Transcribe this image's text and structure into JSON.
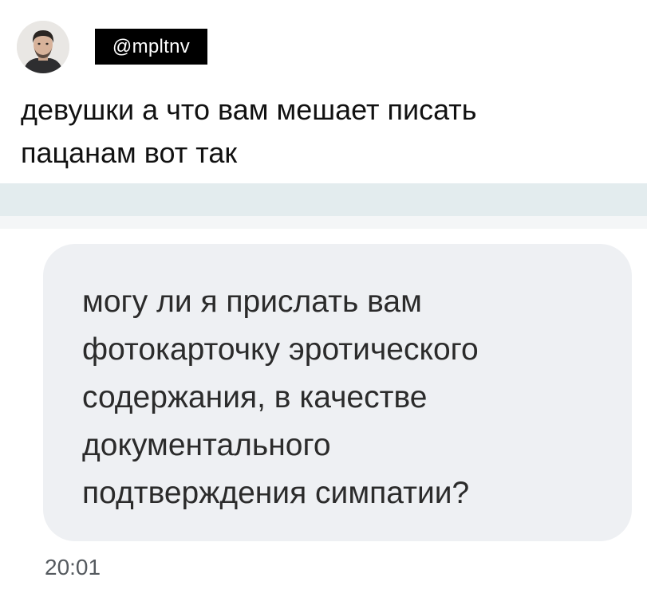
{
  "post": {
    "username": "@mpltnv",
    "text_lines": [
      "девушки а что вам мешает писать",
      "пацанам вот так"
    ]
  },
  "message": {
    "text_lines": [
      "могу ли я прислать вам",
      "фотокарточку эротического",
      "содержания, в качестве",
      "документального",
      "подтверждения симпатии?"
    ],
    "time": "20:01"
  },
  "colors": {
    "separator": "#e3ecee",
    "bubble": "#eef0f3",
    "username_bg": "#000000"
  }
}
